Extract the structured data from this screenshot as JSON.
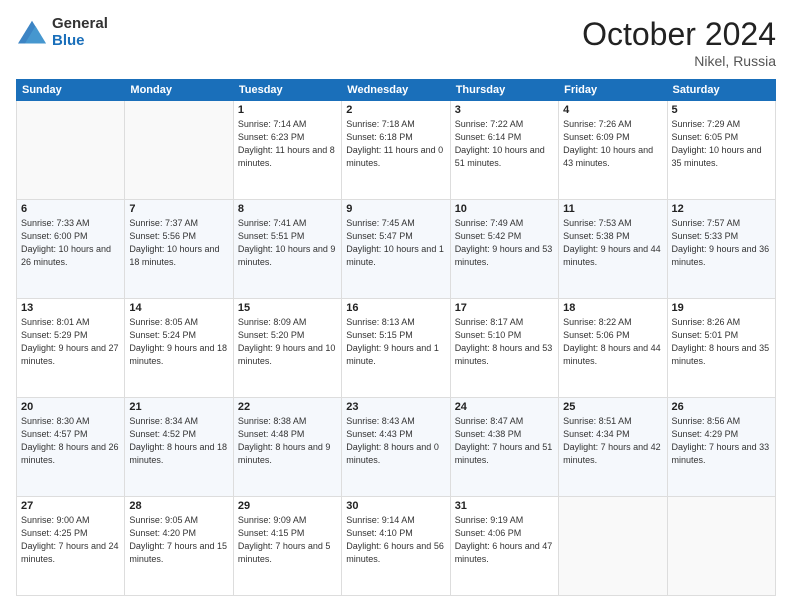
{
  "logo": {
    "general": "General",
    "blue": "Blue"
  },
  "header": {
    "month": "October 2024",
    "location": "Nikel, Russia"
  },
  "weekdays": [
    "Sunday",
    "Monday",
    "Tuesday",
    "Wednesday",
    "Thursday",
    "Friday",
    "Saturday"
  ],
  "weeks": [
    [
      {
        "day": "",
        "sunrise": "",
        "sunset": "",
        "daylight": ""
      },
      {
        "day": "",
        "sunrise": "",
        "sunset": "",
        "daylight": ""
      },
      {
        "day": "1",
        "sunrise": "Sunrise: 7:14 AM",
        "sunset": "Sunset: 6:23 PM",
        "daylight": "Daylight: 11 hours and 8 minutes."
      },
      {
        "day": "2",
        "sunrise": "Sunrise: 7:18 AM",
        "sunset": "Sunset: 6:18 PM",
        "daylight": "Daylight: 11 hours and 0 minutes."
      },
      {
        "day": "3",
        "sunrise": "Sunrise: 7:22 AM",
        "sunset": "Sunset: 6:14 PM",
        "daylight": "Daylight: 10 hours and 51 minutes."
      },
      {
        "day": "4",
        "sunrise": "Sunrise: 7:26 AM",
        "sunset": "Sunset: 6:09 PM",
        "daylight": "Daylight: 10 hours and 43 minutes."
      },
      {
        "day": "5",
        "sunrise": "Sunrise: 7:29 AM",
        "sunset": "Sunset: 6:05 PM",
        "daylight": "Daylight: 10 hours and 35 minutes."
      }
    ],
    [
      {
        "day": "6",
        "sunrise": "Sunrise: 7:33 AM",
        "sunset": "Sunset: 6:00 PM",
        "daylight": "Daylight: 10 hours and 26 minutes."
      },
      {
        "day": "7",
        "sunrise": "Sunrise: 7:37 AM",
        "sunset": "Sunset: 5:56 PM",
        "daylight": "Daylight: 10 hours and 18 minutes."
      },
      {
        "day": "8",
        "sunrise": "Sunrise: 7:41 AM",
        "sunset": "Sunset: 5:51 PM",
        "daylight": "Daylight: 10 hours and 9 minutes."
      },
      {
        "day": "9",
        "sunrise": "Sunrise: 7:45 AM",
        "sunset": "Sunset: 5:47 PM",
        "daylight": "Daylight: 10 hours and 1 minute."
      },
      {
        "day": "10",
        "sunrise": "Sunrise: 7:49 AM",
        "sunset": "Sunset: 5:42 PM",
        "daylight": "Daylight: 9 hours and 53 minutes."
      },
      {
        "day": "11",
        "sunrise": "Sunrise: 7:53 AM",
        "sunset": "Sunset: 5:38 PM",
        "daylight": "Daylight: 9 hours and 44 minutes."
      },
      {
        "day": "12",
        "sunrise": "Sunrise: 7:57 AM",
        "sunset": "Sunset: 5:33 PM",
        "daylight": "Daylight: 9 hours and 36 minutes."
      }
    ],
    [
      {
        "day": "13",
        "sunrise": "Sunrise: 8:01 AM",
        "sunset": "Sunset: 5:29 PM",
        "daylight": "Daylight: 9 hours and 27 minutes."
      },
      {
        "day": "14",
        "sunrise": "Sunrise: 8:05 AM",
        "sunset": "Sunset: 5:24 PM",
        "daylight": "Daylight: 9 hours and 18 minutes."
      },
      {
        "day": "15",
        "sunrise": "Sunrise: 8:09 AM",
        "sunset": "Sunset: 5:20 PM",
        "daylight": "Daylight: 9 hours and 10 minutes."
      },
      {
        "day": "16",
        "sunrise": "Sunrise: 8:13 AM",
        "sunset": "Sunset: 5:15 PM",
        "daylight": "Daylight: 9 hours and 1 minute."
      },
      {
        "day": "17",
        "sunrise": "Sunrise: 8:17 AM",
        "sunset": "Sunset: 5:10 PM",
        "daylight": "Daylight: 8 hours and 53 minutes."
      },
      {
        "day": "18",
        "sunrise": "Sunrise: 8:22 AM",
        "sunset": "Sunset: 5:06 PM",
        "daylight": "Daylight: 8 hours and 44 minutes."
      },
      {
        "day": "19",
        "sunrise": "Sunrise: 8:26 AM",
        "sunset": "Sunset: 5:01 PM",
        "daylight": "Daylight: 8 hours and 35 minutes."
      }
    ],
    [
      {
        "day": "20",
        "sunrise": "Sunrise: 8:30 AM",
        "sunset": "Sunset: 4:57 PM",
        "daylight": "Daylight: 8 hours and 26 minutes."
      },
      {
        "day": "21",
        "sunrise": "Sunrise: 8:34 AM",
        "sunset": "Sunset: 4:52 PM",
        "daylight": "Daylight: 8 hours and 18 minutes."
      },
      {
        "day": "22",
        "sunrise": "Sunrise: 8:38 AM",
        "sunset": "Sunset: 4:48 PM",
        "daylight": "Daylight: 8 hours and 9 minutes."
      },
      {
        "day": "23",
        "sunrise": "Sunrise: 8:43 AM",
        "sunset": "Sunset: 4:43 PM",
        "daylight": "Daylight: 8 hours and 0 minutes."
      },
      {
        "day": "24",
        "sunrise": "Sunrise: 8:47 AM",
        "sunset": "Sunset: 4:38 PM",
        "daylight": "Daylight: 7 hours and 51 minutes."
      },
      {
        "day": "25",
        "sunrise": "Sunrise: 8:51 AM",
        "sunset": "Sunset: 4:34 PM",
        "daylight": "Daylight: 7 hours and 42 minutes."
      },
      {
        "day": "26",
        "sunrise": "Sunrise: 8:56 AM",
        "sunset": "Sunset: 4:29 PM",
        "daylight": "Daylight: 7 hours and 33 minutes."
      }
    ],
    [
      {
        "day": "27",
        "sunrise": "Sunrise: 9:00 AM",
        "sunset": "Sunset: 4:25 PM",
        "daylight": "Daylight: 7 hours and 24 minutes."
      },
      {
        "day": "28",
        "sunrise": "Sunrise: 9:05 AM",
        "sunset": "Sunset: 4:20 PM",
        "daylight": "Daylight: 7 hours and 15 minutes."
      },
      {
        "day": "29",
        "sunrise": "Sunrise: 9:09 AM",
        "sunset": "Sunset: 4:15 PM",
        "daylight": "Daylight: 7 hours and 5 minutes."
      },
      {
        "day": "30",
        "sunrise": "Sunrise: 9:14 AM",
        "sunset": "Sunset: 4:10 PM",
        "daylight": "Daylight: 6 hours and 56 minutes."
      },
      {
        "day": "31",
        "sunrise": "Sunrise: 9:19 AM",
        "sunset": "Sunset: 4:06 PM",
        "daylight": "Daylight: 6 hours and 47 minutes."
      },
      {
        "day": "",
        "sunrise": "",
        "sunset": "",
        "daylight": ""
      },
      {
        "day": "",
        "sunrise": "",
        "sunset": "",
        "daylight": ""
      }
    ]
  ]
}
